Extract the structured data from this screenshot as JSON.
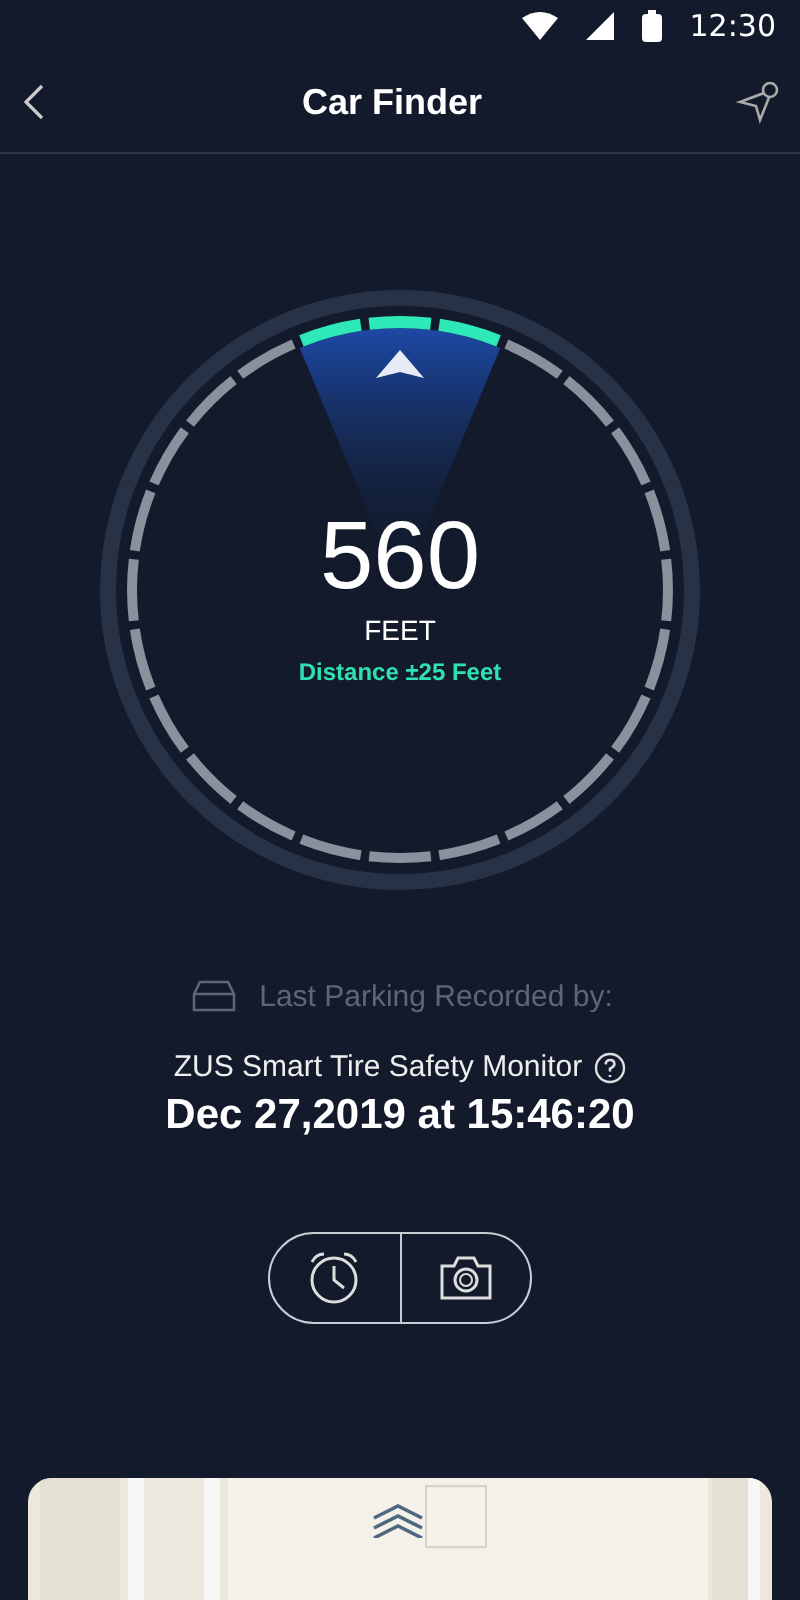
{
  "status_bar": {
    "time": "12:30"
  },
  "header": {
    "title": "Car Finder"
  },
  "gauge": {
    "distance": "560",
    "unit": "FEET",
    "accuracy": "Distance ±25 Feet"
  },
  "parking": {
    "label": "Last Parking Recorded by:",
    "source": "ZUS Smart Tire Safety Monitor",
    "datetime": "Dec 27,2019 at 15:46:20"
  }
}
